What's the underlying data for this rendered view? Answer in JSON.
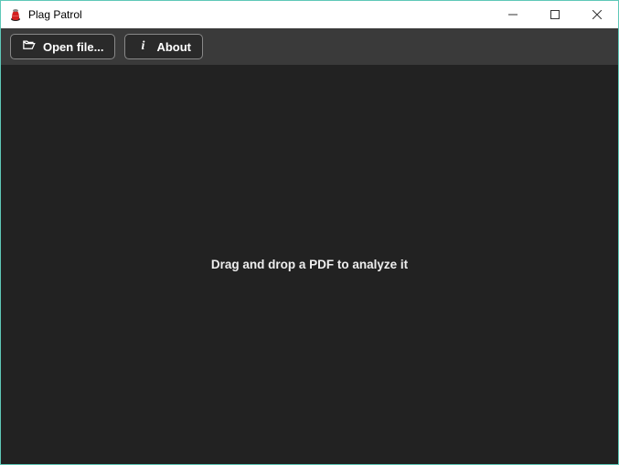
{
  "window": {
    "title": "Plag Patrol"
  },
  "toolbar": {
    "open_label": "Open file...",
    "about_label": "About"
  },
  "content": {
    "drop_hint": "Drag and drop a PDF to analyze it"
  }
}
